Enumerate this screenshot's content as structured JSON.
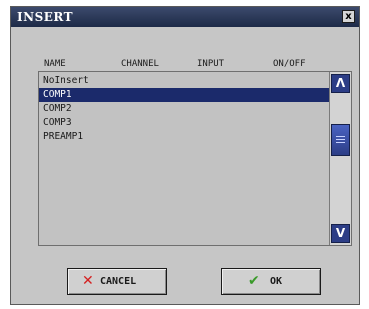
{
  "window": {
    "title": "INSERT",
    "close_label": "x"
  },
  "columns": [
    "NAME",
    "CHANNEL",
    "INPUT",
    "ON/OFF"
  ],
  "list": {
    "items": [
      "NoInsert",
      "COMP1",
      "COMP2",
      "COMP3",
      "PREAMP1"
    ],
    "selected_index": 1
  },
  "scroll": {
    "up_label": "Λ",
    "down_label": "V"
  },
  "buttons": {
    "cancel_label": "CANCEL",
    "ok_label": "OK"
  },
  "icons": {
    "cancel": "x-icon",
    "ok": "checkmark-icon"
  },
  "colors": {
    "title_bar": "#1d2a47",
    "selection": "#1b2a6b",
    "scroll_accent": "#2c3d86",
    "cancel_icon": "#d42020",
    "ok_icon": "#3a9a2a"
  }
}
